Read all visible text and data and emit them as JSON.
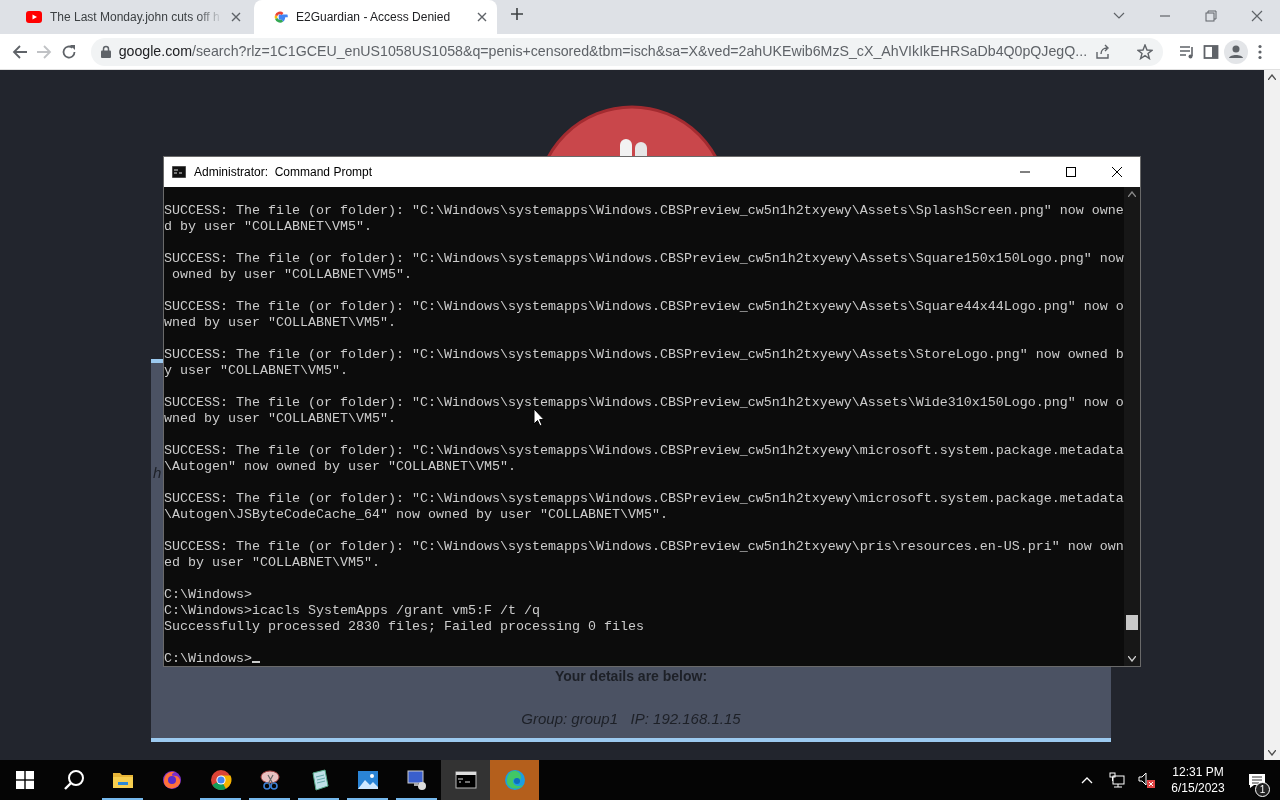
{
  "browser": {
    "tabs": [
      {
        "kind": "video",
        "title": "The Last Monday.john cuts off h",
        "selected": false
      },
      {
        "kind": "search",
        "title": "E2Guardian - Access Denied",
        "selected": true
      }
    ],
    "nav": {
      "forward_enabled": false
    },
    "address": {
      "host": "google.com",
      "path": "/search?rlz=1C1GCEU_enUS1058US1058&q=penis+censored&tbm=isch&sa=X&ved=2ahUKEwib6MzS_cX_AhVIkIkEHRSaDb4Q0pQJegQ..."
    }
  },
  "page": {
    "fragment": "h",
    "details_heading": "Your details are below:",
    "details": "Group: group1   IP: 192.168.1.15"
  },
  "console_window": {
    "title": "Administrator:  Command Prompt",
    "blocks": [
      [
        "SUCCESS: The file (or folder): \"C:\\Windows\\systemapps\\Windows.CBSPreview_cw5n1h2txyewy\\Assets\\SplashScreen.png\" now owne",
        "d by user \"COLLABNET\\VM5\"."
      ],
      [
        "SUCCESS: The file (or folder): \"C:\\Windows\\systemapps\\Windows.CBSPreview_cw5n1h2txyewy\\Assets\\Square150x150Logo.png\" now",
        " owned by user \"COLLABNET\\VM5\"."
      ],
      [
        "SUCCESS: The file (or folder): \"C:\\Windows\\systemapps\\Windows.CBSPreview_cw5n1h2txyewy\\Assets\\Square44x44Logo.png\" now o",
        "wned by user \"COLLABNET\\VM5\"."
      ],
      [
        "SUCCESS: The file (or folder): \"C:\\Windows\\systemapps\\Windows.CBSPreview_cw5n1h2txyewy\\Assets\\StoreLogo.png\" now owned b",
        "y user \"COLLABNET\\VM5\"."
      ],
      [
        "SUCCESS: The file (or folder): \"C:\\Windows\\systemapps\\Windows.CBSPreview_cw5n1h2txyewy\\Assets\\Wide310x150Logo.png\" now o",
        "wned by user \"COLLABNET\\VM5\"."
      ],
      [
        "SUCCESS: The file (or folder): \"C:\\Windows\\systemapps\\Windows.CBSPreview_cw5n1h2txyewy\\microsoft.system.package.metadata",
        "\\Autogen\" now owned by user \"COLLABNET\\VM5\"."
      ],
      [
        "SUCCESS: The file (or folder): \"C:\\Windows\\systemapps\\Windows.CBSPreview_cw5n1h2txyewy\\microsoft.system.package.metadata",
        "\\Autogen\\JSByteCodeCache_64\" now owned by user \"COLLABNET\\VM5\"."
      ],
      [
        "SUCCESS: The file (or folder): \"C:\\Windows\\systemapps\\Windows.CBSPreview_cw5n1h2txyewy\\pris\\resources.en-US.pri\" now own",
        "ed by user \"COLLABNET\\VM5\"."
      ],
      [
        "C:\\Windows>",
        "C:\\Windows>icacls SystemApps /grant vm5:F /t /q",
        "Successfully processed 2830 files; Failed processing 0 files"
      ],
      [
        "C:\\Windows>"
      ]
    ]
  },
  "taskbar": {
    "apps": [
      {
        "kind": "files",
        "running": true,
        "active": false,
        "attention": false
      },
      {
        "kind": "fox",
        "running": false,
        "active": false,
        "attention": false
      },
      {
        "kind": "wheel",
        "running": true,
        "active": false,
        "attention": false
      },
      {
        "kind": "scissors",
        "running": true,
        "active": false,
        "attention": false
      },
      {
        "kind": "notepad",
        "running": true,
        "active": false,
        "attention": false
      },
      {
        "kind": "image",
        "running": true,
        "active": false,
        "attention": false
      },
      {
        "kind": "computer",
        "running": true,
        "active": false,
        "attention": false
      },
      {
        "kind": "terminal",
        "running": false,
        "active": true,
        "attention": false
      },
      {
        "kind": "swirl",
        "running": false,
        "active": false,
        "attention": true
      }
    ],
    "clock": {
      "time": "12:31 PM",
      "date": "6/15/2023"
    },
    "notifications": "1"
  }
}
